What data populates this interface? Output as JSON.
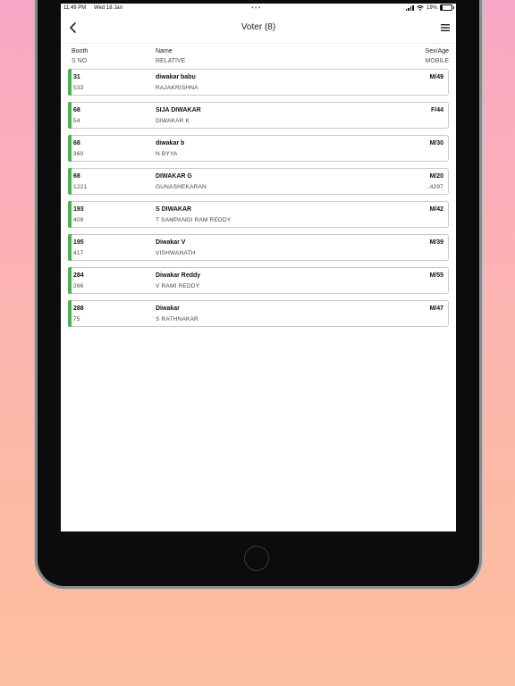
{
  "status": {
    "time": "11:49 PM",
    "date": "Wed 18 Jan",
    "battery": "19%",
    "battery_level": 0.19
  },
  "nav": {
    "title": "Voter (8)"
  },
  "columns": {
    "booth": "Booth",
    "sno": "S NO",
    "name": "Name",
    "relative": "RELATIVE",
    "sexage": "Sex/Age",
    "mobile": "MOBILE"
  },
  "colors": {
    "accent": "#4caf50"
  },
  "voters": [
    {
      "booth": "31",
      "sno": "533",
      "name": "diwakar babu",
      "relative": "RAJAKRISHNA",
      "sexage": "M/49",
      "mobile": ""
    },
    {
      "booth": "68",
      "sno": "54",
      "name": "SIJA DIWAKAR",
      "relative": "DIWAKAR K",
      "sexage": "F/44",
      "mobile": ""
    },
    {
      "booth": "68",
      "sno": "360",
      "name": "diwakar b",
      "relative": "N BYYA",
      "sexage": "M/30",
      "mobile": ""
    },
    {
      "booth": "68",
      "sno": "1221",
      "name": "DIWAKAR G",
      "relative": "GUNASHEKARAN",
      "sexage": "M/20",
      "mobile": "..4297"
    },
    {
      "booth": "193",
      "sno": "409",
      "name": "S DIWAKAR",
      "relative": "T SAMPANGI RAM REDDY",
      "sexage": "M/42",
      "mobile": ""
    },
    {
      "booth": "195",
      "sno": "417",
      "name": "Diwakar V",
      "relative": "VISHWANATH",
      "sexage": "M/39",
      "mobile": ""
    },
    {
      "booth": "284",
      "sno": "266",
      "name": "Diwakar Reddy",
      "relative": "V RAMI REDDY",
      "sexage": "M/55",
      "mobile": ""
    },
    {
      "booth": "288",
      "sno": "75",
      "name": "Diwakar",
      "relative": "S RATHNAKAR",
      "sexage": "M/47",
      "mobile": ""
    }
  ]
}
